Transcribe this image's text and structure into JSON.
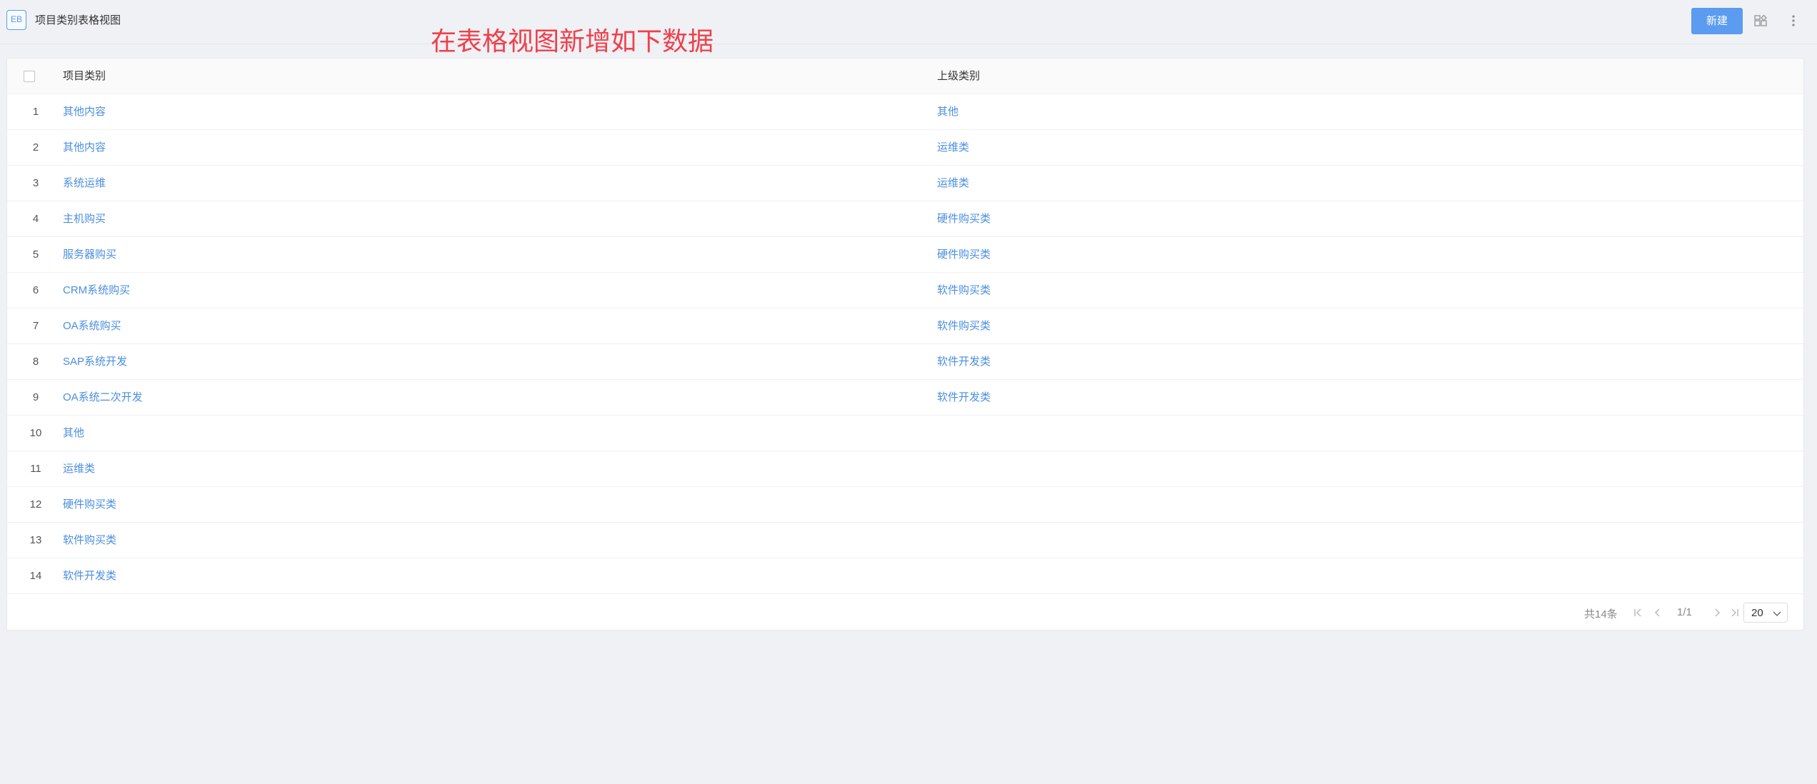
{
  "app": {
    "badge": "EB",
    "title": "项目类别表格视图"
  },
  "annotation": "在表格视图新增如下数据",
  "toolbar": {
    "new_label": "新建",
    "layout_icon": "layout-icon",
    "more_icon": "more-vertical-icon"
  },
  "table": {
    "columns": [
      "项目类别",
      "上级类别"
    ],
    "rows": [
      {
        "n": "1",
        "name": "其他内容",
        "parent": "其他"
      },
      {
        "n": "2",
        "name": "其他内容",
        "parent": "运维类"
      },
      {
        "n": "3",
        "name": "系统运维",
        "parent": "运维类"
      },
      {
        "n": "4",
        "name": "主机购买",
        "parent": "硬件购买类"
      },
      {
        "n": "5",
        "name": "服务器购买",
        "parent": "硬件购买类"
      },
      {
        "n": "6",
        "name": "CRM系统购买",
        "parent": "软件购买类"
      },
      {
        "n": "7",
        "name": "OA系统购买",
        "parent": "软件购买类"
      },
      {
        "n": "8",
        "name": "SAP系统开发",
        "parent": "软件开发类"
      },
      {
        "n": "9",
        "name": "OA系统二次开发",
        "parent": "软件开发类"
      },
      {
        "n": "10",
        "name": "其他",
        "parent": ""
      },
      {
        "n": "11",
        "name": "运维类",
        "parent": ""
      },
      {
        "n": "12",
        "name": "硬件购买类",
        "parent": ""
      },
      {
        "n": "13",
        "name": "软件购买类",
        "parent": ""
      },
      {
        "n": "14",
        "name": "软件开发类",
        "parent": ""
      }
    ]
  },
  "pagination": {
    "total": "共14条",
    "page": "1/1",
    "page_size": "20"
  }
}
